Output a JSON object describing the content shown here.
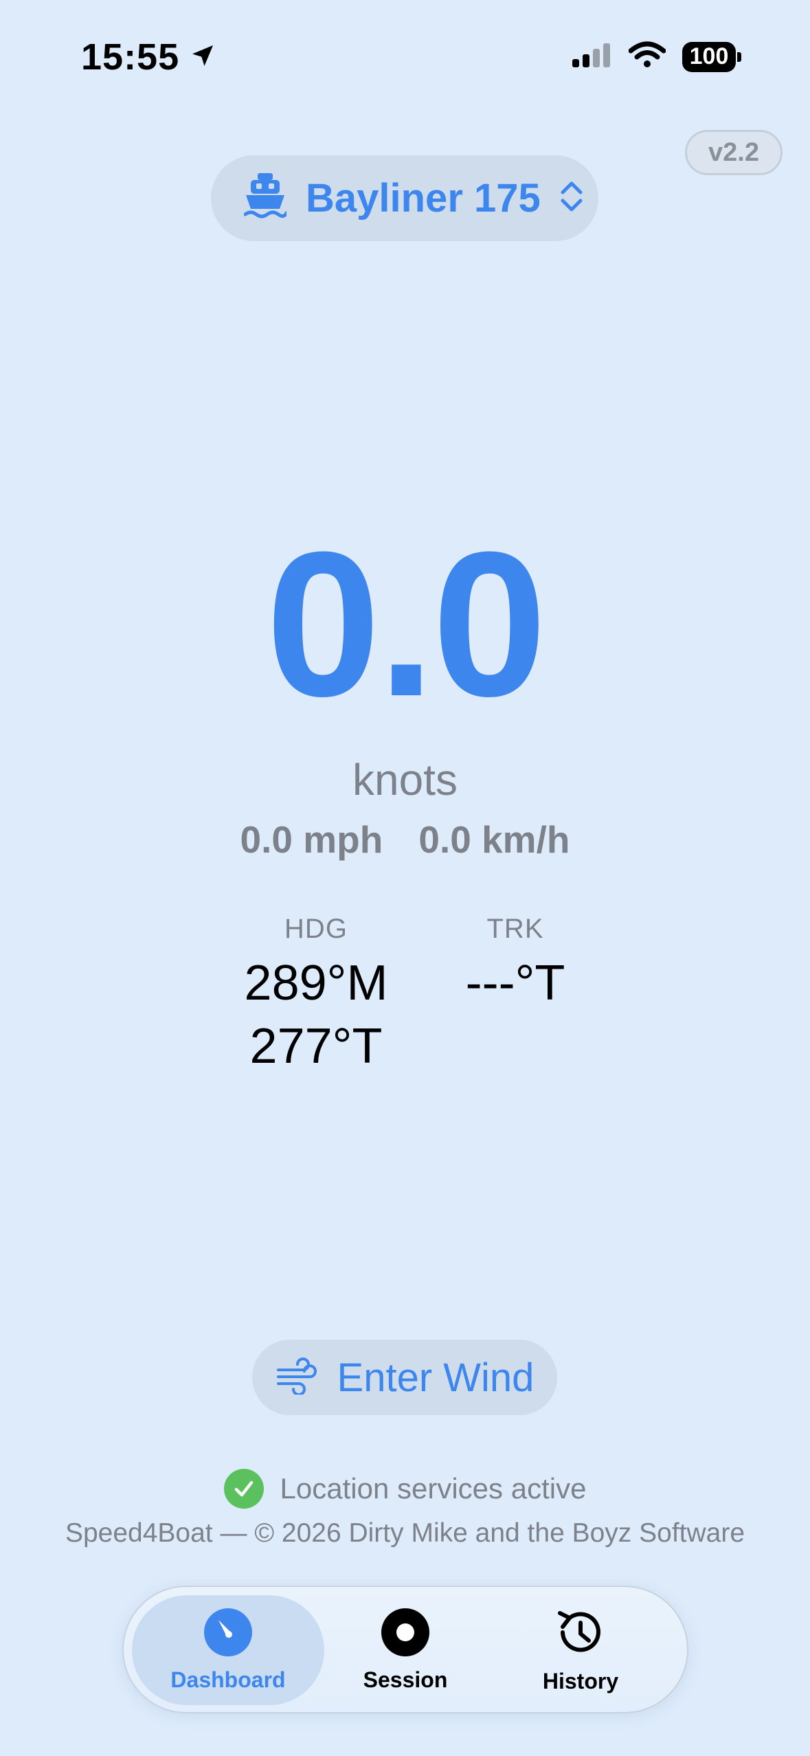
{
  "status_bar": {
    "time": "15:55",
    "battery": "100"
  },
  "version_badge": "v2.2",
  "boat_selector": {
    "name": "Bayliner 175"
  },
  "speed": {
    "value": "0.0",
    "unit": "knots",
    "mph": "0.0 mph",
    "kmh": "0.0 km/h"
  },
  "heading": {
    "label": "HDG",
    "magnetic": "289°M",
    "true": "277°T"
  },
  "track": {
    "label": "TRK",
    "value": "---°T"
  },
  "wind_button": {
    "label": "Enter Wind"
  },
  "location_status": "Location services active",
  "footer": "Speed4Boat — © 2026 Dirty Mike and the Boyz Software",
  "tabs": [
    {
      "label": "Dashboard",
      "active": true
    },
    {
      "label": "Session",
      "active": false
    },
    {
      "label": "History",
      "active": false
    }
  ],
  "colors": {
    "accent": "#3D86EE",
    "background": "#DDEBFB",
    "muted": "#7C818A",
    "success": "#5BC15F"
  }
}
